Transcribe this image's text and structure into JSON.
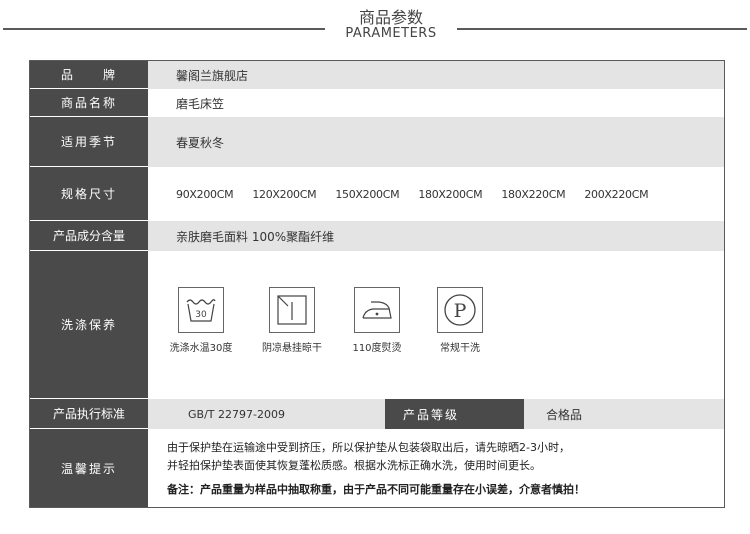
{
  "header": {
    "title_cn": "商品参数",
    "title_en": "PARAMETERS"
  },
  "rows": {
    "brand": {
      "label": "品　　牌",
      "value": "馨阁兰旗舰店"
    },
    "name": {
      "label": "商品名称",
      "value": "磨毛床笠"
    },
    "season": {
      "label": "适用季节",
      "value": "春夏秋冬"
    },
    "size": {
      "label": "规格尺寸",
      "values": [
        "90X200CM",
        "120X200CM",
        "150X200CM",
        "180X200CM",
        "180X220CM",
        "200X220CM"
      ]
    },
    "material": {
      "label": "产品成分含量",
      "value": "亲肤磨毛面料  100%聚酯纤维"
    },
    "care": {
      "label": "洗涤保养",
      "items": [
        {
          "icon": "wash-30-icon",
          "symbol": "30",
          "caption": "洗涤水温30度"
        },
        {
          "icon": "drip-dry-shade-icon",
          "caption": "阴凉悬挂晾干"
        },
        {
          "icon": "iron-110-icon",
          "caption": "110度熨烫"
        },
        {
          "icon": "dry-clean-p-icon",
          "symbol": "P",
          "caption": "常规干洗"
        }
      ]
    },
    "standard": {
      "label": "产品执行标准",
      "value": "GB/T 22797-2009",
      "grade_label": "产品等级",
      "grade_value": "合格品"
    },
    "tips": {
      "label": "温馨提示",
      "line1": "由于保护垫在运输途中受到挤压，所以保护垫从包装袋取出后，请先晾晒2-3小时，",
      "line2": "并轻拍保护垫表面使其恢复蓬松质感。根据水洗标正确水洗，使用时间更长。",
      "note": "备注：产品重量为样品中抽取称重，由于产品不同可能重量存在小误差，介意者慎拍！"
    }
  }
}
